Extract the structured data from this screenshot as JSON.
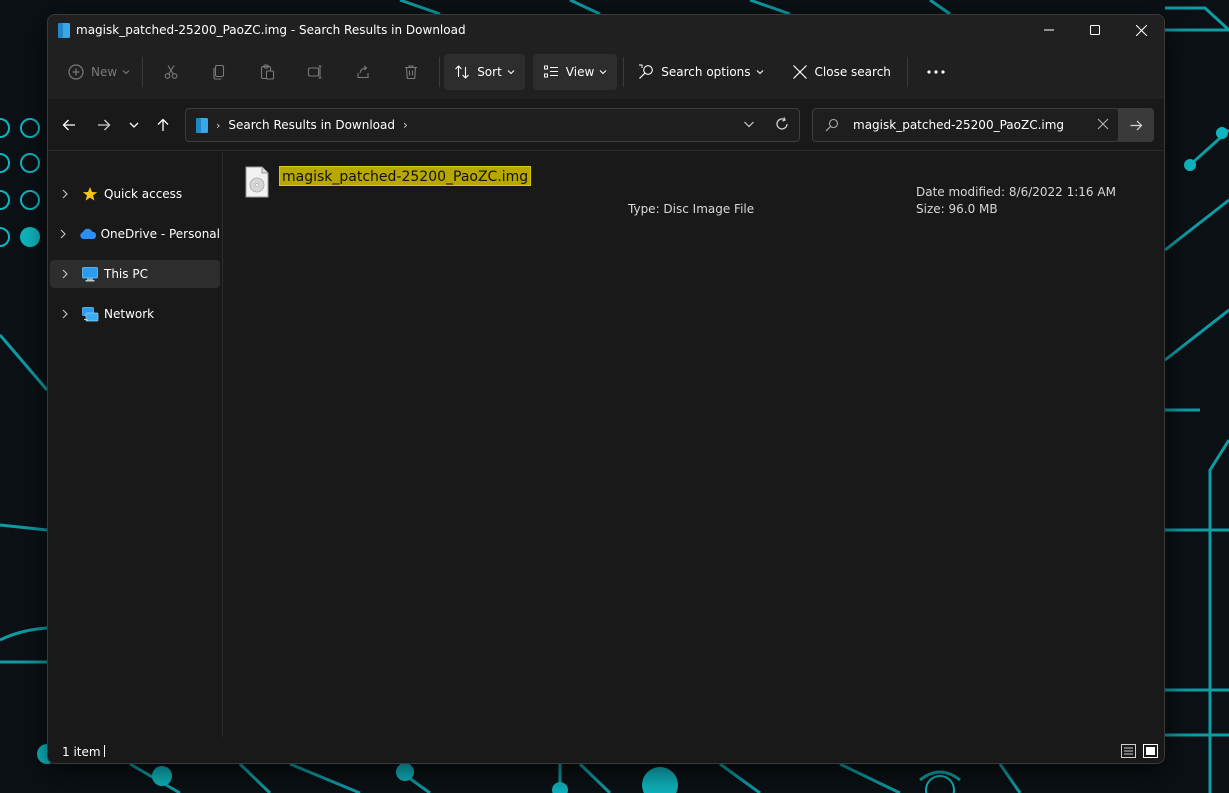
{
  "window": {
    "title": "magisk_patched-25200_PaoZC.img - Search Results in Download",
    "controls": {
      "minimize": "minimize-icon",
      "maximize": "maximize-icon",
      "close": "close-icon"
    }
  },
  "toolbar": {
    "new_label": "New",
    "sort_label": "Sort",
    "view_label": "View",
    "search_options_label": "Search options",
    "close_search_label": "Close search",
    "icons": [
      "plus-circle-icon",
      "cut-icon",
      "copy-icon",
      "paste-icon",
      "rename-icon",
      "share-icon",
      "delete-icon",
      "sort-icon",
      "view-icon",
      "search-options-icon",
      "close-search-icon",
      "more-icon"
    ]
  },
  "address": {
    "crumbs": [
      "Search Results in Download"
    ]
  },
  "search": {
    "value": "magisk_patched-25200_PaoZC.img"
  },
  "sidebar": {
    "items": [
      {
        "label": "Quick access",
        "icon": "star-icon"
      },
      {
        "label": "OneDrive - Personal",
        "icon": "cloud-icon"
      },
      {
        "label": "This PC",
        "icon": "monitor-icon",
        "selected": true
      },
      {
        "label": "Network",
        "icon": "network-icon"
      }
    ]
  },
  "results": [
    {
      "name": "magisk_patched-25200_PaoZC.img",
      "type_line": "Type: Disc Image File",
      "date_line": "Date modified: 8/6/2022 1:16 AM",
      "size_line": "Size: 96.0 MB",
      "icon": "disc-image-file-icon"
    }
  ],
  "status": {
    "count": "1 item"
  },
  "colors": {
    "accent": "#00c8d4",
    "highlight": "#b7a800",
    "window_bg": "#191919",
    "toolbar_bg": "#202020"
  }
}
